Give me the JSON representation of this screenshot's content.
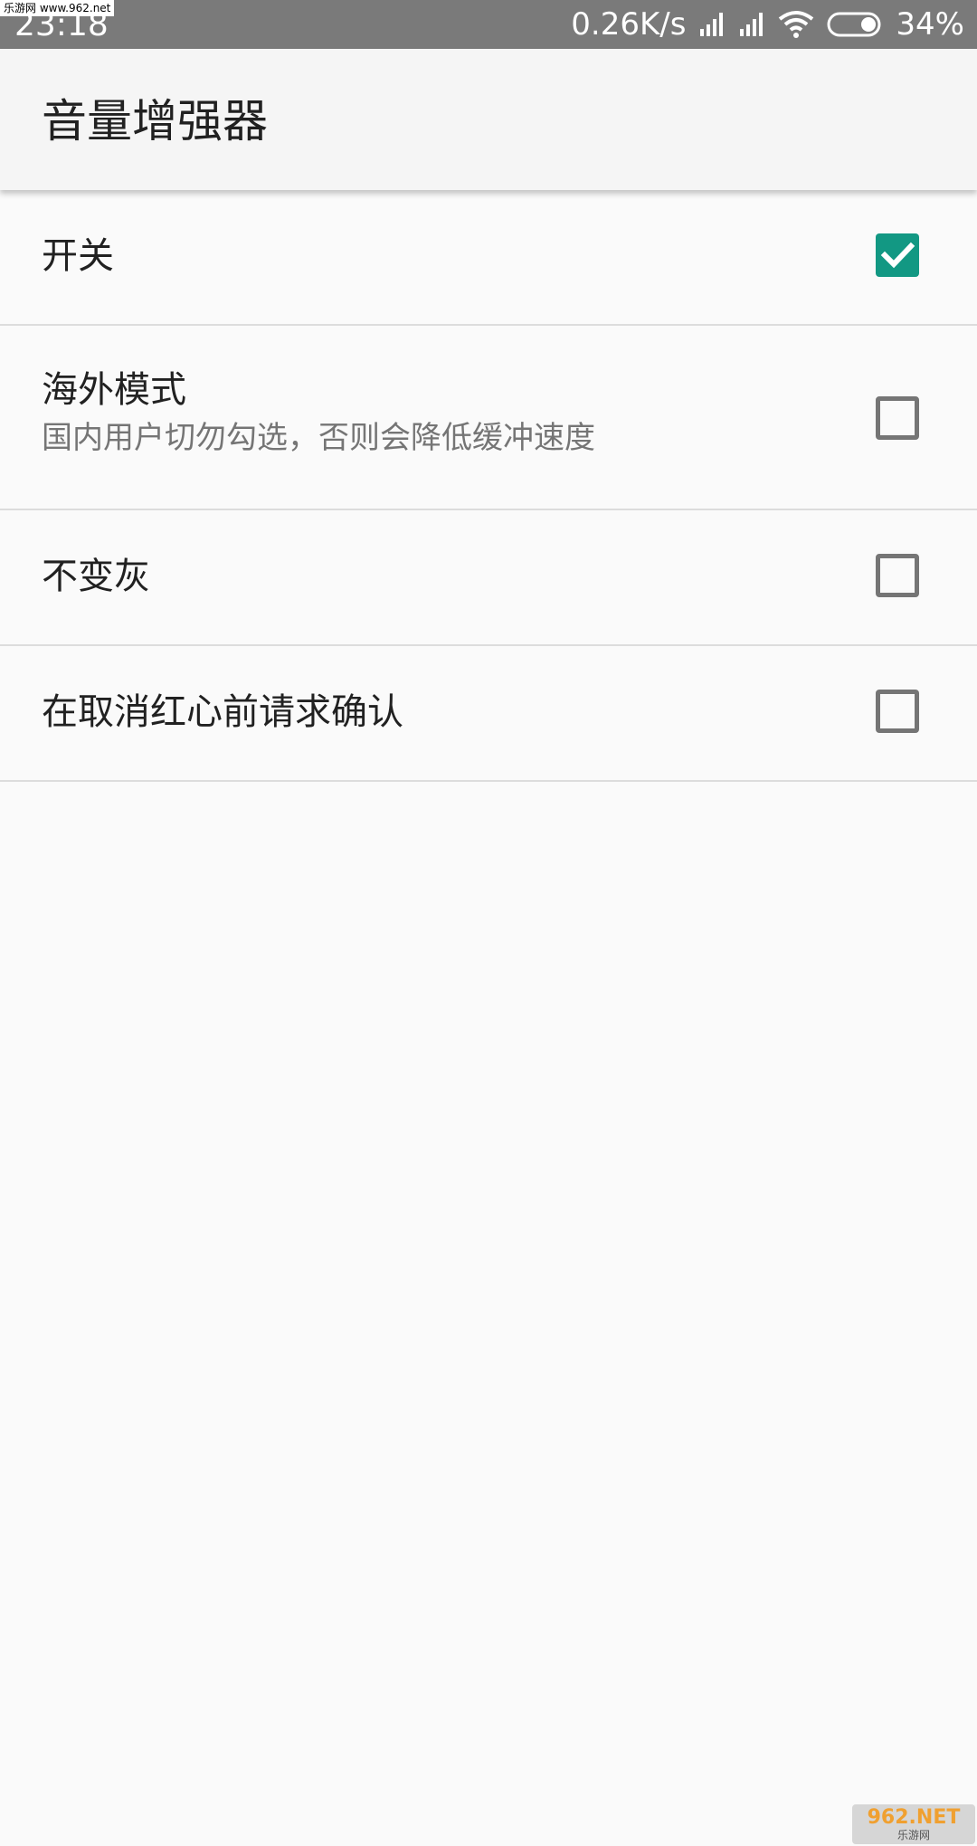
{
  "watermark_top": "乐游网 www.962.net",
  "status_bar": {
    "time": "23:18",
    "net_speed": "0.26K/s",
    "battery_percent": "34%",
    "icons": [
      "signal-bars-icon",
      "signal-bars-icon",
      "wifi-icon",
      "battery-icon"
    ]
  },
  "app_bar": {
    "title": "音量增强器"
  },
  "accent_color": "#129883",
  "preferences": [
    {
      "title": "开关",
      "summary": "",
      "checked": true
    },
    {
      "title": "海外模式",
      "summary": "国内用户切勿勾选，否则会降低缓冲速度",
      "checked": false
    },
    {
      "title": "不变灰",
      "summary": "",
      "checked": false
    },
    {
      "title": "在取消红心前请求确认",
      "summary": "",
      "checked": false
    }
  ],
  "watermark_bottom": {
    "brand": "962.NET",
    "subtitle": "乐游网"
  }
}
